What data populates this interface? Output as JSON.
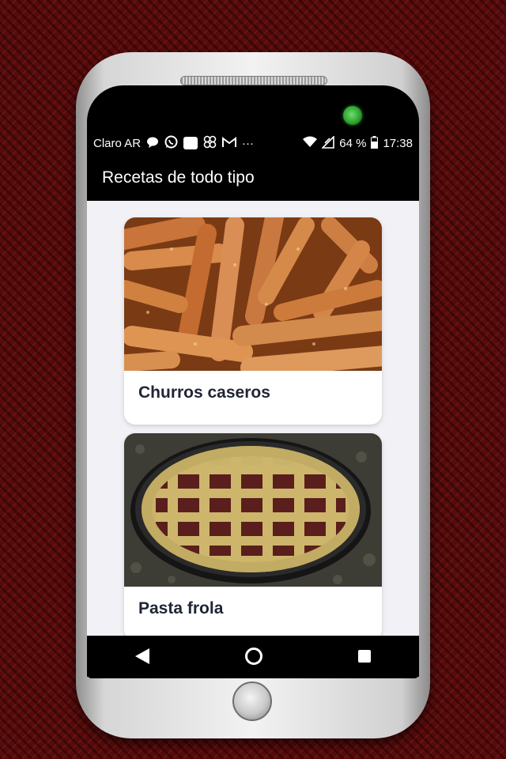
{
  "status_bar": {
    "carrier": "Claro AR",
    "icons": [
      "message-icon",
      "whatsapp-icon",
      "notification-icon",
      "pinwheel-icon",
      "gmail-icon",
      "more-icon"
    ],
    "more_glyph": "···",
    "battery": "64 %",
    "time": "17:38"
  },
  "app_bar": {
    "title": "Recetas de todo tipo"
  },
  "recipes": [
    {
      "name": "Churros caseros",
      "image": "churros-photo"
    },
    {
      "name": "Pasta frola",
      "image": "pasta-frola-photo"
    }
  ],
  "nav_bar": {
    "buttons": [
      "back",
      "home",
      "recent-apps"
    ]
  },
  "colors": {
    "app_bar": "#000000",
    "background": "#f1f1f6",
    "title_text": "#1f2533",
    "wallpaper": "#5a0a0a"
  }
}
